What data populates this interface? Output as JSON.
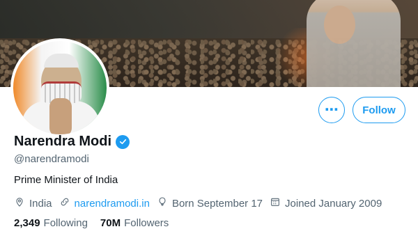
{
  "actions": {
    "more_label": "⋯",
    "follow_label": "Follow"
  },
  "profile": {
    "name": "Narendra Modi",
    "handle": "@narendramodi",
    "bio": "Prime Minister of India",
    "location": "India",
    "website": "narendramodi.in",
    "birthday": "Born September 17",
    "joined": "Joined January 2009"
  },
  "stats": {
    "following_count": "2,349",
    "following_label": "Following",
    "followers_count": "70M",
    "followers_label": "Followers"
  },
  "colors": {
    "accent": "#1d9bf0",
    "text": "#0f1419",
    "secondary_text": "#536471"
  },
  "icons": {
    "verified": "verified-badge-icon",
    "location": "location-pin-icon",
    "link": "link-icon",
    "birthday": "balloon-icon",
    "joined": "calendar-icon",
    "more": "more-horizontal-icon"
  }
}
